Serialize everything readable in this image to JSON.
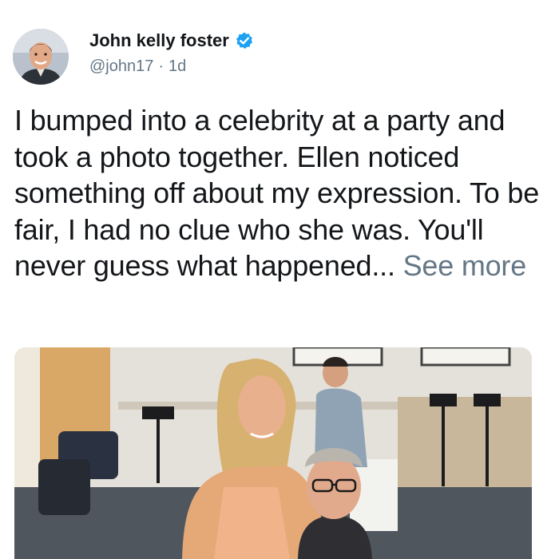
{
  "tweet": {
    "author": {
      "display_name": "John kelly foster",
      "handle": "@john17",
      "separator": "·",
      "time": "1d",
      "verified": true,
      "avatar_icon": "user-avatar-photo",
      "verified_color": "#1da1f2"
    },
    "text": "I bumped into a celebrity at a party and took a photo together. Ellen noticed something off about my expression. To be fair, I had no clue who she was. You'll never guess what happened...",
    "see_more": "See more",
    "media_icon": "photo-two-people-in-office-lounge"
  }
}
